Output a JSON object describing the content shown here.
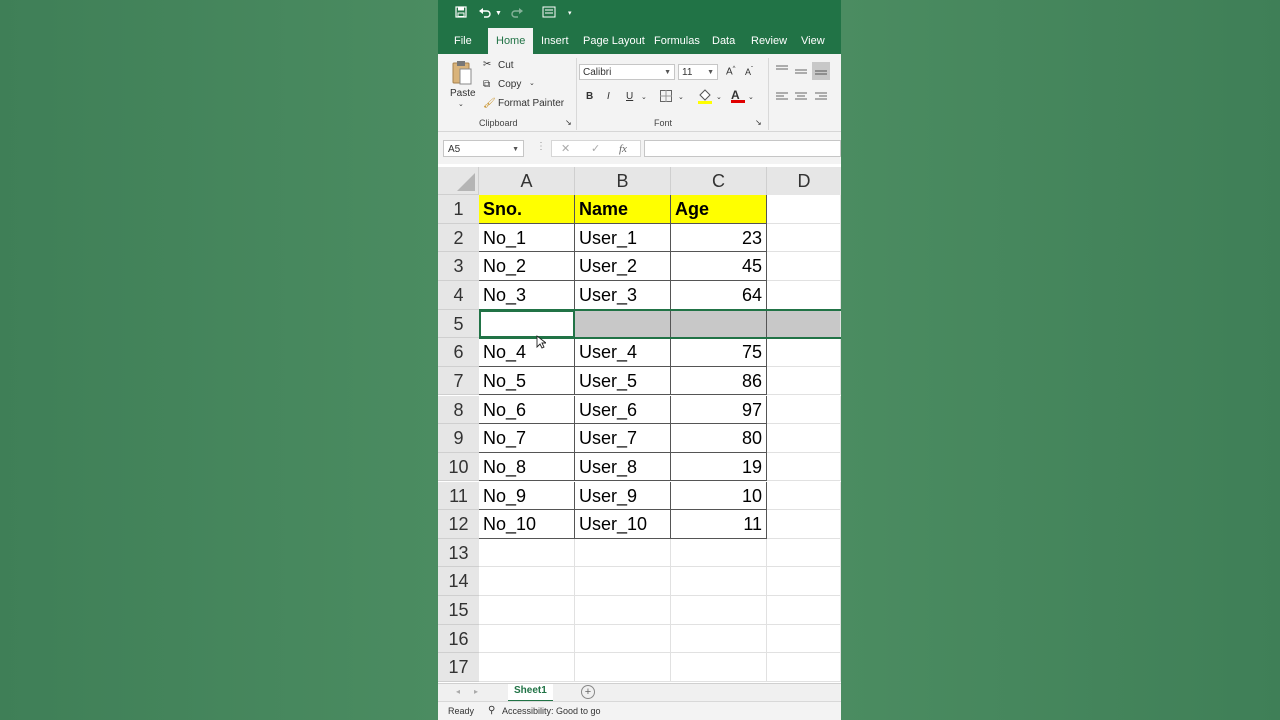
{
  "colors": {
    "accent": "#217346",
    "header_fill": "#ffff00"
  },
  "qat": {
    "save_icon": "save-icon",
    "undo_icon": "undo-icon",
    "redo_icon": "redo-icon",
    "form_icon": "form-icon",
    "more_icon": "customize-qat-icon"
  },
  "tabs": [
    "File",
    "Home",
    "Insert",
    "Page Layout",
    "Formulas",
    "Data",
    "Review",
    "View"
  ],
  "ribbon": {
    "clipboard": {
      "paste": "Paste",
      "cut": "Cut",
      "copy": "Copy",
      "format_painter": "Format Painter",
      "label": "Clipboard"
    },
    "font": {
      "name": "Calibri",
      "size": "11",
      "grow": "A",
      "shrink": "A",
      "bold": "B",
      "italic": "I",
      "underline": "U",
      "label": "Font",
      "font_color": "A"
    }
  },
  "formula_bar": {
    "name_box": "A5",
    "cancel": "✕",
    "enter": "✓",
    "fx": "fx",
    "value": ""
  },
  "columns": [
    "A",
    "B",
    "C",
    "D"
  ],
  "rows": [
    {
      "n": "1",
      "a": "Sno.",
      "b": "Name",
      "c": "Age"
    },
    {
      "n": "2",
      "a": "No_1",
      "b": "User_1",
      "c": "23"
    },
    {
      "n": "3",
      "a": "No_2",
      "b": "User_2",
      "c": "45"
    },
    {
      "n": "4",
      "a": "No_3",
      "b": "User_3",
      "c": "64"
    },
    {
      "n": "5",
      "a": "",
      "b": "",
      "c": ""
    },
    {
      "n": "6",
      "a": "No_4",
      "b": "User_4",
      "c": "75"
    },
    {
      "n": "7",
      "a": "No_5",
      "b": "User_5",
      "c": "86"
    },
    {
      "n": "8",
      "a": "No_6",
      "b": "User_6",
      "c": "97"
    },
    {
      "n": "9",
      "a": "No_7",
      "b": "User_7",
      "c": "80"
    },
    {
      "n": "10",
      "a": "No_8",
      "b": "User_8",
      "c": "19"
    },
    {
      "n": "11",
      "a": "No_9",
      "b": "User_9",
      "c": "10"
    },
    {
      "n": "12",
      "a": "No_10",
      "b": "User_10",
      "c": "11"
    },
    {
      "n": "13",
      "a": "",
      "b": "",
      "c": ""
    },
    {
      "n": "14",
      "a": "",
      "b": "",
      "c": ""
    },
    {
      "n": "15",
      "a": "",
      "b": "",
      "c": ""
    },
    {
      "n": "16",
      "a": "",
      "b": "",
      "c": ""
    },
    {
      "n": "17",
      "a": "",
      "b": "",
      "c": ""
    }
  ],
  "sheet": {
    "tab": "Sheet1",
    "add": "+"
  },
  "status": {
    "ready": "Ready",
    "accessibility": "Accessibility: Good to go"
  }
}
